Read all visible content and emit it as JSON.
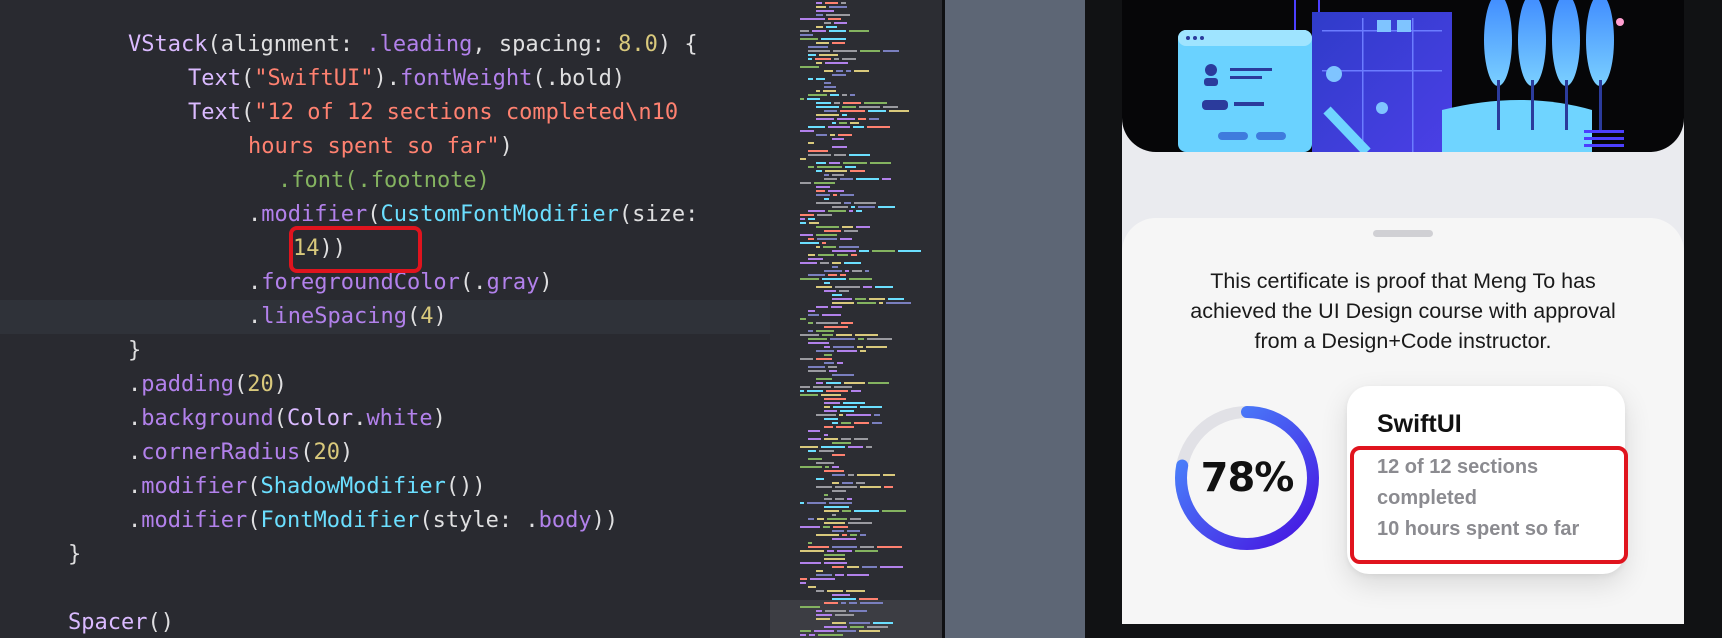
{
  "editor": {
    "lines": [
      {
        "tokens": [
          {
            "t": "VStack",
            "c": "t-type"
          },
          {
            "t": "(alignment: ",
            "c": "t-default"
          },
          {
            "t": ".leading",
            "c": "t-method"
          },
          {
            "t": ", spacing: ",
            "c": "t-default"
          },
          {
            "t": "8.0",
            "c": "t-number"
          },
          {
            "t": ") {",
            "c": "t-default"
          }
        ]
      },
      {
        "tokens": [
          {
            "t": "Text",
            "c": "t-type"
          },
          {
            "t": "(",
            "c": "t-default"
          },
          {
            "t": "\"SwiftUI\"",
            "c": "t-string"
          },
          {
            "t": ").",
            "c": "t-default"
          },
          {
            "t": "fontWeight",
            "c": "t-method"
          },
          {
            "t": "(.bold)",
            "c": "t-default"
          }
        ]
      },
      {
        "tokens": [
          {
            "t": "Text",
            "c": "t-type"
          },
          {
            "t": "(",
            "c": "t-default"
          },
          {
            "t": "\"12 of 12 sections completed\\n10",
            "c": "t-string"
          }
        ]
      },
      {
        "tokens": [
          {
            "t": "hours spent so far\"",
            "c": "t-string"
          },
          {
            "t": ")",
            "c": "t-default"
          }
        ]
      },
      {
        "tokens": [
          {
            "t": ".font(.footnote)",
            "c": "t-comment"
          }
        ]
      },
      {
        "tokens": [
          {
            "t": ".",
            "c": "t-default"
          },
          {
            "t": "modifier",
            "c": "t-method"
          },
          {
            "t": "(",
            "c": "t-default"
          },
          {
            "t": "CustomFontModifier",
            "c": "t-typeName"
          },
          {
            "t": "(size:",
            "c": "t-default"
          }
        ]
      },
      {
        "tokens": [
          {
            "t": "14",
            "c": "t-number"
          },
          {
            "t": "))",
            "c": "t-default"
          }
        ]
      },
      {
        "tokens": [
          {
            "t": ".",
            "c": "t-default"
          },
          {
            "t": "foregroundColor",
            "c": "t-method"
          },
          {
            "t": "(.",
            "c": "t-default"
          },
          {
            "t": "gray",
            "c": "t-method"
          },
          {
            "t": ")",
            "c": "t-default"
          }
        ]
      },
      {
        "tokens": [
          {
            "t": ".",
            "c": "t-default"
          },
          {
            "t": "lineSpacing",
            "c": "t-method"
          },
          {
            "t": "(",
            "c": "t-default"
          },
          {
            "t": "4",
            "c": "t-number"
          },
          {
            "t": ")",
            "c": "t-default"
          }
        ]
      },
      {
        "tokens": [
          {
            "t": "}",
            "c": "t-default"
          }
        ]
      },
      {
        "tokens": [
          {
            "t": ".",
            "c": "t-default"
          },
          {
            "t": "padding",
            "c": "t-method"
          },
          {
            "t": "(",
            "c": "t-default"
          },
          {
            "t": "20",
            "c": "t-number"
          },
          {
            "t": ")",
            "c": "t-default"
          }
        ]
      },
      {
        "tokens": [
          {
            "t": ".",
            "c": "t-default"
          },
          {
            "t": "background",
            "c": "t-method"
          },
          {
            "t": "(",
            "c": "t-default"
          },
          {
            "t": "Color",
            "c": "t-type"
          },
          {
            "t": ".",
            "c": "t-default"
          },
          {
            "t": "white",
            "c": "t-method"
          },
          {
            "t": ")",
            "c": "t-default"
          }
        ]
      },
      {
        "tokens": [
          {
            "t": ".",
            "c": "t-default"
          },
          {
            "t": "cornerRadius",
            "c": "t-method"
          },
          {
            "t": "(",
            "c": "t-default"
          },
          {
            "t": "20",
            "c": "t-number"
          },
          {
            "t": ")",
            "c": "t-default"
          }
        ]
      },
      {
        "tokens": [
          {
            "t": ".",
            "c": "t-default"
          },
          {
            "t": "modifier",
            "c": "t-method"
          },
          {
            "t": "(",
            "c": "t-default"
          },
          {
            "t": "ShadowModifier",
            "c": "t-typeName"
          },
          {
            "t": "())",
            "c": "t-default"
          }
        ]
      },
      {
        "tokens": [
          {
            "t": ".",
            "c": "t-default"
          },
          {
            "t": "modifier",
            "c": "t-method"
          },
          {
            "t": "(",
            "c": "t-default"
          },
          {
            "t": "FontModifier",
            "c": "t-typeName"
          },
          {
            "t": "(style: .",
            "c": "t-default"
          },
          {
            "t": "body",
            "c": "t-method"
          },
          {
            "t": "))",
            "c": "t-default"
          }
        ]
      },
      {
        "tokens": [
          {
            "t": "}",
            "c": "t-default"
          }
        ]
      },
      {
        "tokens": []
      },
      {
        "tokens": [
          {
            "t": "Spacer",
            "c": "t-type"
          },
          {
            "t": "()",
            "c": "t-default"
          }
        ]
      }
    ]
  },
  "preview": {
    "certificate_text": "This certificate is proof that Meng To has\nachieved the UI Design course with approval\nfrom a Design+Code instructor.",
    "progress_label": "78%",
    "progress_value": 0.78,
    "course_title": "SwiftUI",
    "course_subtitle": "12 of 12 sections\ncompleted\n10 hours spent so far",
    "colors": {
      "ring_start": "#4a95ff",
      "ring_end": "#4610e0",
      "ring_track": "#e1e1e6",
      "annotation_red": "#e0141e"
    }
  }
}
